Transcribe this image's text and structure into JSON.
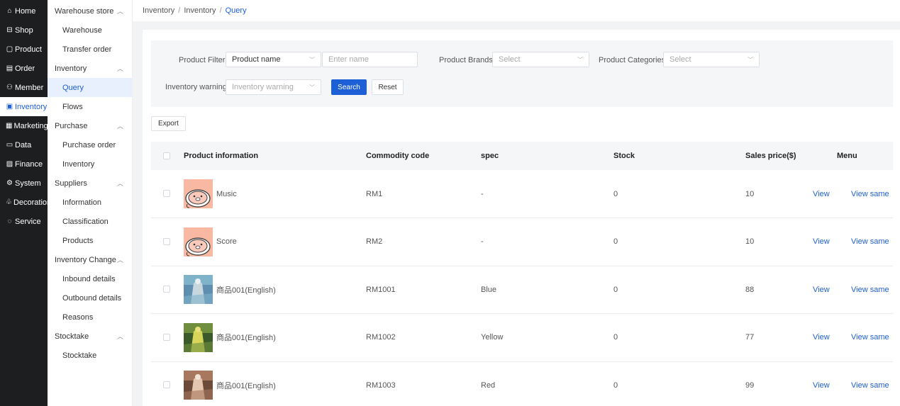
{
  "main_nav": [
    {
      "label": "Home",
      "icon": "home-icon",
      "glyph": "⌂"
    },
    {
      "label": "Shop",
      "icon": "shop-icon",
      "glyph": "⊟"
    },
    {
      "label": "Product",
      "icon": "product-icon",
      "glyph": "▢"
    },
    {
      "label": "Order",
      "icon": "order-icon",
      "glyph": "▤"
    },
    {
      "label": "Member",
      "icon": "member-icon",
      "glyph": "⚇"
    },
    {
      "label": "Inventory",
      "icon": "inventory-icon",
      "glyph": "▣",
      "active": true
    },
    {
      "label": "Marketing",
      "icon": "marketing-icon",
      "glyph": "▦"
    },
    {
      "label": "Data",
      "icon": "data-icon",
      "glyph": "▭"
    },
    {
      "label": "Finance",
      "icon": "finance-icon",
      "glyph": "▨"
    },
    {
      "label": "System",
      "icon": "system-icon",
      "glyph": "⚙"
    },
    {
      "label": "Decoration",
      "icon": "decoration-icon",
      "glyph": "♧"
    },
    {
      "label": "Service",
      "icon": "service-icon",
      "glyph": "◌"
    }
  ],
  "sub_nav": [
    {
      "type": "group",
      "label": "Warehouse store"
    },
    {
      "type": "item",
      "label": "Warehouse"
    },
    {
      "type": "item",
      "label": "Transfer order"
    },
    {
      "type": "group",
      "label": "Inventory"
    },
    {
      "type": "item",
      "label": "Query",
      "active": true
    },
    {
      "type": "item",
      "label": "Flows"
    },
    {
      "type": "group",
      "label": "Purchase"
    },
    {
      "type": "item",
      "label": "Purchase order"
    },
    {
      "type": "item",
      "label": "Inventory"
    },
    {
      "type": "group",
      "label": "Suppliers"
    },
    {
      "type": "item",
      "label": "Information"
    },
    {
      "type": "item",
      "label": "Classification"
    },
    {
      "type": "item",
      "label": "Products"
    },
    {
      "type": "group",
      "label": "Inventory Change"
    },
    {
      "type": "item",
      "label": "Inbound details"
    },
    {
      "type": "item",
      "label": "Outbound details"
    },
    {
      "type": "item",
      "label": "Reasons"
    },
    {
      "type": "group",
      "label": "Stocktake"
    },
    {
      "type": "item",
      "label": "Stocktake"
    }
  ],
  "breadcrumb": {
    "c1": "Inventory",
    "c2": "Inventory",
    "c3": "Query",
    "sep": "/"
  },
  "filters": {
    "product_filter_label": "Product Filter:",
    "product_filter_type": "Product name",
    "name_placeholder": "Enter name",
    "brands_label": "Product Brands:",
    "brands_placeholder": "Select",
    "categories_label": "Product Categories:",
    "categories_placeholder": "Select",
    "warning_label": "Inventory warning:",
    "warning_placeholder": "Inventory warning",
    "search_label": "Search",
    "reset_label": "Reset"
  },
  "export_label": "Export",
  "table": {
    "headers": {
      "product": "Product information",
      "code": "Commodity code",
      "spec": "spec",
      "stock": "Stock",
      "price": "Sales price($)",
      "menu": "Menu"
    },
    "view_label": "View",
    "view_same_label": "View same",
    "rows": [
      {
        "name": "Music",
        "code": "RM1",
        "spec": "-",
        "stock": "0",
        "price": "10",
        "thumb": "pig"
      },
      {
        "name": "Score",
        "code": "RM2",
        "spec": "-",
        "stock": "0",
        "price": "10",
        "thumb": "pig"
      },
      {
        "name": "商品001(English)",
        "code": "RM1001",
        "spec": "Blue",
        "stock": "0",
        "price": "88",
        "thumb": "photo-blue"
      },
      {
        "name": "商品001(English)",
        "code": "RM1002",
        "spec": "Yellow",
        "stock": "0",
        "price": "77",
        "thumb": "photo-yellow"
      },
      {
        "name": "商品001(English)",
        "code": "RM1003",
        "spec": "Red",
        "stock": "0",
        "price": "99",
        "thumb": "photo-red"
      }
    ]
  }
}
